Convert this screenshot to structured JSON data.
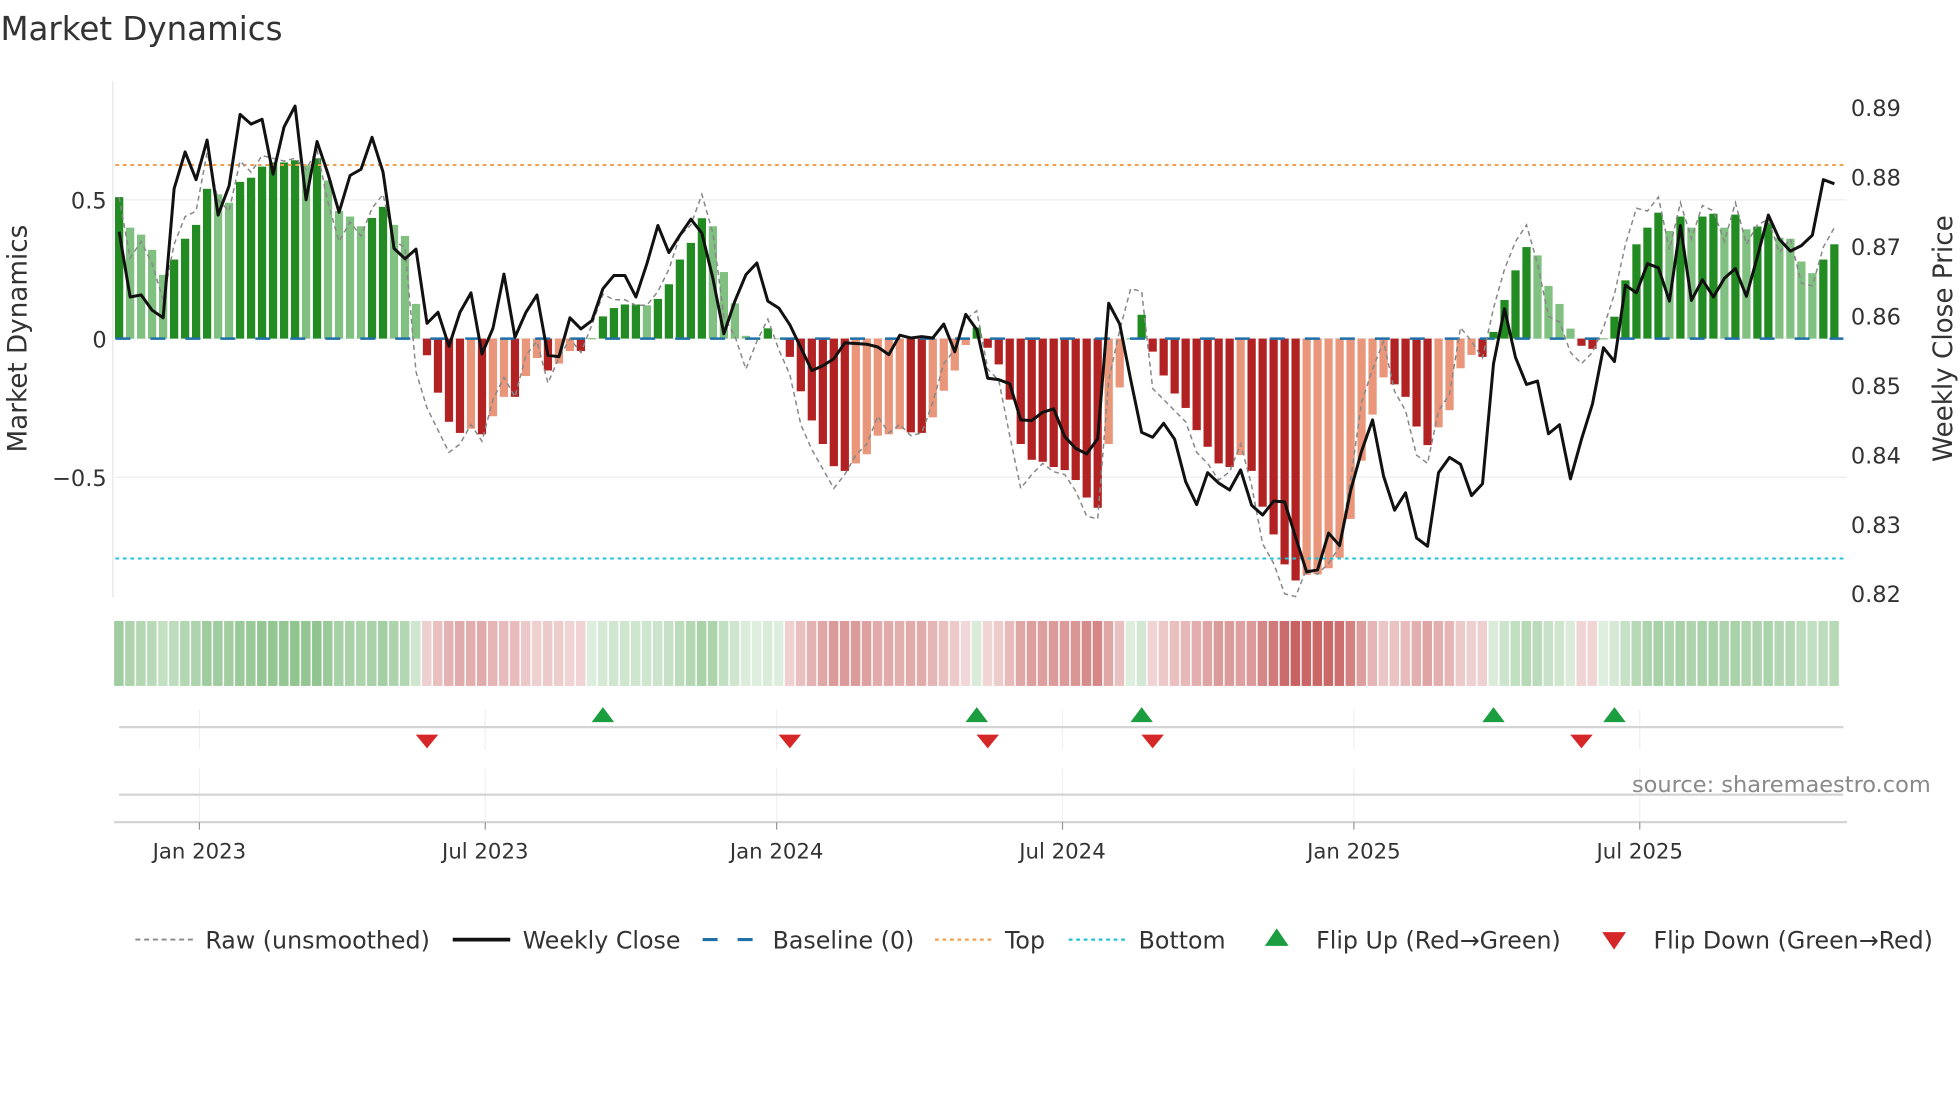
{
  "chart_data": {
    "type": "bar",
    "title": "Market Dynamics",
    "ylabel": "Market Dynamics",
    "ylabel_right": "Weekly Close Price",
    "ylim": [
      -0.93,
      0.96
    ],
    "ylim_right": [
      0.8184,
      0.8929
    ],
    "yticks": [
      {
        "value": 0.5,
        "label": "0.5"
      },
      {
        "value": 0,
        "label": "0"
      },
      {
        "value": -0.5,
        "label": "−0.5"
      }
    ],
    "yticks_right": [
      {
        "value": 0.89,
        "label": "0.89"
      },
      {
        "value": 0.88,
        "label": "0.88"
      },
      {
        "value": 0.87,
        "label": "0.87"
      },
      {
        "value": 0.86,
        "label": "0.86"
      },
      {
        "value": 0.85,
        "label": "0.85"
      },
      {
        "value": 0.84,
        "label": "0.84"
      },
      {
        "value": 0.83,
        "label": "0.83"
      },
      {
        "value": 0.82,
        "label": "0.82"
      }
    ],
    "x_unit": "week index",
    "xticks": [
      {
        "value": 7.3,
        "label": "Jan 2023"
      },
      {
        "value": 33.3,
        "label": "Jul 2023"
      },
      {
        "value": 59.8,
        "label": "Jan 2024"
      },
      {
        "value": 85.8,
        "label": "Jul 2024"
      },
      {
        "value": 112.3,
        "label": "Jan 2025"
      },
      {
        "value": 138.3,
        "label": "Jul 2025"
      }
    ],
    "thresholds": {
      "baseline": 0,
      "top": 0.626,
      "bottom": -0.793
    },
    "series": [
      {
        "name": "Market Dynamics (smoothed)",
        "type": "bar",
        "values": [
          0.51,
          0.4,
          0.375,
          0.32,
          0.23,
          0.285,
          0.36,
          0.41,
          0.54,
          0.52,
          0.49,
          0.565,
          0.58,
          0.62,
          0.635,
          0.635,
          0.643,
          0.625,
          0.65,
          0.57,
          0.46,
          0.44,
          0.405,
          0.435,
          0.475,
          0.41,
          0.37,
          0.125,
          -0.06,
          -0.195,
          -0.3,
          -0.34,
          -0.325,
          -0.345,
          -0.28,
          -0.21,
          -0.21,
          -0.135,
          -0.07,
          -0.115,
          -0.09,
          -0.045,
          -0.045,
          0.0,
          0.08,
          0.11,
          0.123,
          0.123,
          0.12,
          0.143,
          0.196,
          0.285,
          0.345,
          0.434,
          0.405,
          0.24,
          0.127,
          0.01,
          0.0,
          0.037,
          0.0,
          -0.066,
          -0.19,
          -0.295,
          -0.38,
          -0.46,
          -0.477,
          -0.45,
          -0.417,
          -0.35,
          -0.345,
          -0.327,
          -0.338,
          -0.34,
          -0.284,
          -0.188,
          -0.115,
          -0.023,
          0.04,
          -0.033,
          -0.093,
          -0.22,
          -0.38,
          -0.437,
          -0.444,
          -0.463,
          -0.474,
          -0.51,
          -0.573,
          -0.61,
          -0.38,
          -0.176,
          0.0,
          0.086,
          -0.047,
          -0.133,
          -0.198,
          -0.25,
          -0.33,
          -0.39,
          -0.45,
          -0.463,
          -0.42,
          -0.477,
          -0.606,
          -0.706,
          -0.814,
          -0.872,
          -0.852,
          -0.85,
          -0.828,
          -0.79,
          -0.65,
          -0.44,
          -0.274,
          -0.14,
          -0.165,
          -0.21,
          -0.317,
          -0.384,
          -0.32,
          -0.258,
          -0.107,
          -0.059,
          -0.066,
          0.024,
          0.139,
          0.246,
          0.33,
          0.3,
          0.19,
          0.125,
          0.036,
          -0.026,
          -0.037,
          0.0,
          0.079,
          0.21,
          0.34,
          0.4,
          0.454,
          0.388,
          0.44,
          0.4,
          0.44,
          0.45,
          0.4,
          0.447,
          0.394,
          0.404,
          0.418,
          0.364,
          0.36,
          0.278,
          0.236,
          0.285,
          0.34
        ]
      },
      {
        "name": "Raw (unsmoothed)",
        "type": "line",
        "values": [
          0.51,
          0.29,
          0.35,
          0.27,
          0.14,
          0.34,
          0.44,
          0.46,
          0.67,
          0.5,
          0.46,
          0.64,
          0.6,
          0.66,
          0.65,
          0.64,
          0.65,
          0.61,
          0.68,
          0.49,
          0.35,
          0.42,
          0.37,
          0.47,
          0.52,
          0.35,
          0.33,
          -0.12,
          -0.25,
          -0.33,
          -0.41,
          -0.38,
          -0.31,
          -0.37,
          -0.22,
          -0.14,
          -0.21,
          -0.06,
          -0.01,
          -0.16,
          -0.07,
          0.0,
          -0.05,
          0.05,
          0.16,
          0.14,
          0.14,
          0.12,
          0.12,
          0.17,
          0.25,
          0.37,
          0.41,
          0.52,
          0.38,
          0.08,
          0.01,
          -0.11,
          -0.01,
          0.07,
          -0.04,
          -0.13,
          -0.31,
          -0.4,
          -0.47,
          -0.54,
          -0.49,
          -0.42,
          -0.38,
          -0.28,
          -0.34,
          -0.31,
          -0.35,
          -0.34,
          -0.23,
          -0.09,
          -0.04,
          0.07,
          0.1,
          -0.11,
          -0.15,
          -0.35,
          -0.54,
          -0.49,
          -0.45,
          -0.48,
          -0.49,
          -0.55,
          -0.64,
          -0.65,
          -0.15,
          0.03,
          0.18,
          0.17,
          -0.18,
          -0.22,
          -0.26,
          -0.3,
          -0.41,
          -0.45,
          -0.51,
          -0.48,
          -0.38,
          -0.53,
          -0.74,
          -0.81,
          -0.92,
          -0.93,
          -0.83,
          -0.85,
          -0.81,
          -0.75,
          -0.51,
          -0.23,
          -0.11,
          -0.01,
          -0.19,
          -0.26,
          -0.42,
          -0.45,
          -0.26,
          -0.2,
          0.04,
          -0.01,
          -0.07,
          0.11,
          0.25,
          0.35,
          0.41,
          0.27,
          0.08,
          0.06,
          -0.05,
          -0.09,
          -0.05,
          0.04,
          0.16,
          0.34,
          0.47,
          0.46,
          0.51,
          0.32,
          0.49,
          0.36,
          0.48,
          0.46,
          0.35,
          0.49,
          0.34,
          0.41,
          0.43,
          0.31,
          0.36,
          0.2,
          0.19,
          0.33,
          0.4
        ]
      },
      {
        "name": "Weekly Close",
        "type": "line",
        "axis": "right",
        "values": [
          0.8721,
          0.8627,
          0.863,
          0.8608,
          0.8597,
          0.8783,
          0.8836,
          0.8796,
          0.8853,
          0.8745,
          0.8787,
          0.889,
          0.8876,
          0.8883,
          0.8804,
          0.8872,
          0.8902,
          0.8767,
          0.8851,
          0.8804,
          0.8749,
          0.8802,
          0.8811,
          0.8857,
          0.8807,
          0.8697,
          0.8682,
          0.8696,
          0.8589,
          0.8605,
          0.8556,
          0.8605,
          0.8633,
          0.8545,
          0.8582,
          0.866,
          0.8569,
          0.8605,
          0.863,
          0.8543,
          0.8541,
          0.8597,
          0.8581,
          0.8593,
          0.8639,
          0.8658,
          0.8658,
          0.8627,
          0.8675,
          0.873,
          0.8691,
          0.8716,
          0.8739,
          0.8719,
          0.8654,
          0.8574,
          0.8621,
          0.8659,
          0.8676,
          0.8621,
          0.8611,
          0.8587,
          0.8554,
          0.8521,
          0.8528,
          0.8538,
          0.8561,
          0.856,
          0.8559,
          0.8555,
          0.8544,
          0.8572,
          0.8568,
          0.857,
          0.8568,
          0.8588,
          0.8548,
          0.8602,
          0.858,
          0.851,
          0.8508,
          0.8502,
          0.845,
          0.8449,
          0.8461,
          0.8466,
          0.8426,
          0.8409,
          0.8401,
          0.8423,
          0.8618,
          0.8588,
          0.8508,
          0.8432,
          0.8425,
          0.8445,
          0.8422,
          0.8361,
          0.8328,
          0.8374,
          0.8359,
          0.8349,
          0.8378,
          0.8327,
          0.8313,
          0.8333,
          0.8332,
          0.8281,
          0.8231,
          0.8234,
          0.8287,
          0.8269,
          0.8348,
          0.8405,
          0.845,
          0.8369,
          0.832,
          0.8345,
          0.828,
          0.8268,
          0.8374,
          0.8396,
          0.8386,
          0.8341,
          0.8358,
          0.8531,
          0.861,
          0.854,
          0.8501,
          0.8506,
          0.843,
          0.8443,
          0.8365,
          0.8422,
          0.8473,
          0.8554,
          0.8534,
          0.8644,
          0.8633,
          0.8675,
          0.8669,
          0.8621,
          0.873,
          0.8622,
          0.8652,
          0.8627,
          0.8654,
          0.8668,
          0.8628,
          0.8685,
          0.8745,
          0.871,
          0.8693,
          0.8701,
          0.8716,
          0.8796,
          0.879
        ]
      }
    ],
    "flips_up": [
      44,
      78,
      93,
      125,
      136
    ],
    "flips_down": [
      28,
      61,
      79,
      94,
      133
    ],
    "colors": {
      "green_strong": "#228b22",
      "green_weak": "#80c080",
      "red_strong": "#b22222",
      "red_weak": "#e9967a",
      "close": "#111111",
      "raw": "#888888",
      "baseline": "#1f6fa8",
      "top": "#f0a050",
      "bottom": "#22c3d6",
      "flip_up": "#1a9e3f",
      "flip_down": "#d62728"
    },
    "legend": [
      {
        "label": "Raw (unsmoothed)",
        "kind": "raw"
      },
      {
        "label": "Weekly Close",
        "kind": "close"
      },
      {
        "label": "Baseline (0)",
        "kind": "baseline"
      },
      {
        "label": "Top",
        "kind": "top"
      },
      {
        "label": "Bottom",
        "kind": "bottom"
      },
      {
        "label": "Flip Up (Red→Green)",
        "kind": "flip_up"
      },
      {
        "label": "Flip Down (Green→Red)",
        "kind": "flip_down"
      }
    ],
    "legend_position": "bottom"
  },
  "source": "source: sharemaestro.com"
}
